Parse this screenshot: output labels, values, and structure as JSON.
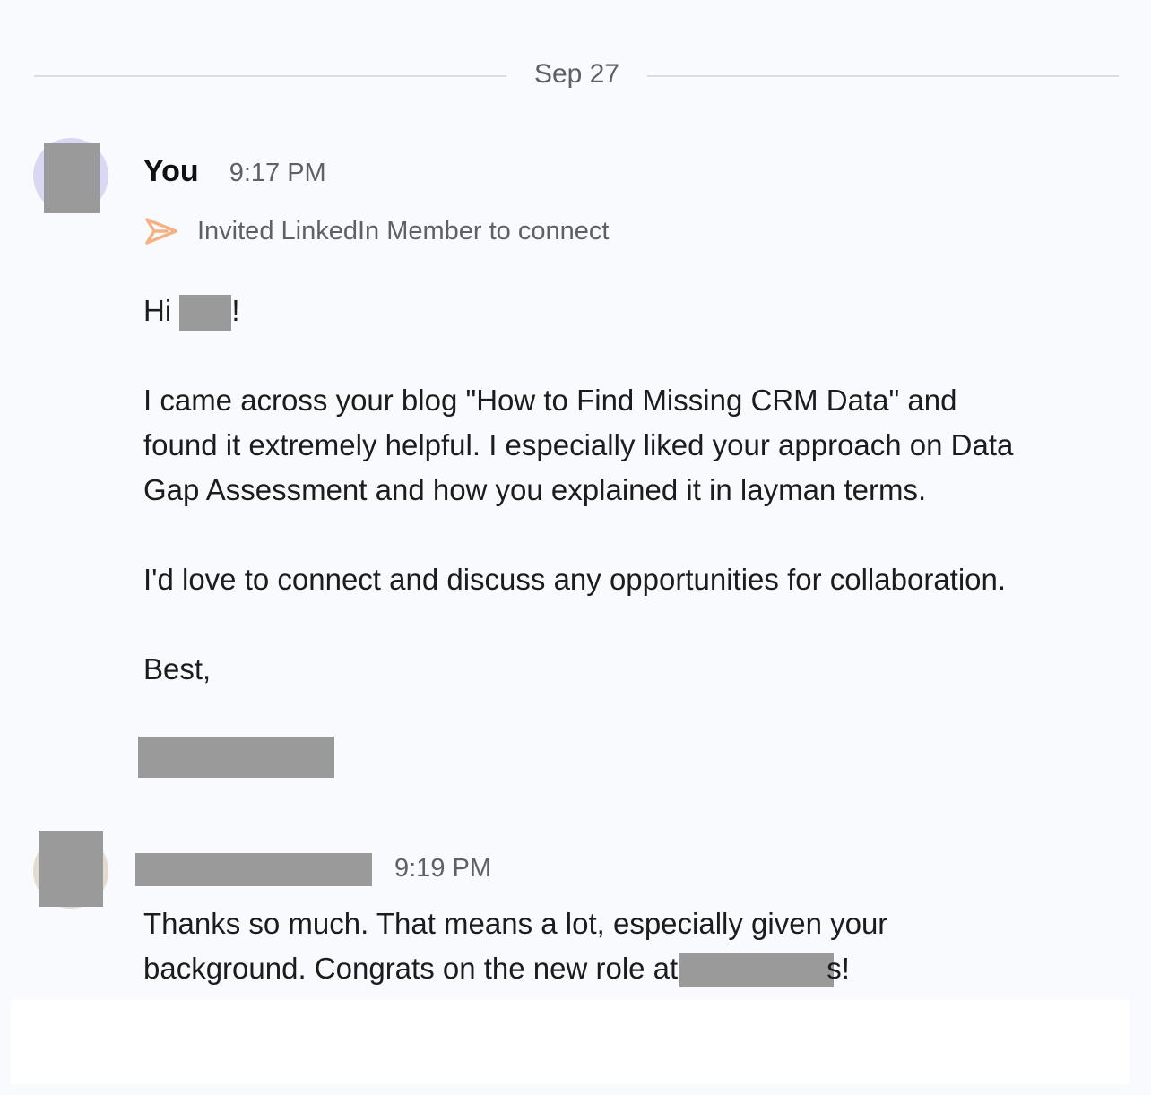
{
  "thread": {
    "date_divider": "Sep 27",
    "messages": [
      {
        "sender": "You",
        "time": "9:17 PM",
        "event_icon": "send-icon",
        "event_text": "Invited LinkedIn Member to connect",
        "greeting_start": "Hi ",
        "greeting_end": "!",
        "paragraph_1_line_1": "I came across your blog \"How to Find Missing CRM Data\" and",
        "paragraph_1_line_2": "found it extremely helpful. I especially liked your approach on Data",
        "paragraph_1_line_3": "Gap Assessment and how you explained it in layman terms.",
        "paragraph_2": "I'd love to connect and discuss any opportunities for collaboration.",
        "signoff": "Best,"
      },
      {
        "time": "9:19 PM",
        "line_1": "Thanks so much. That means a lot, especially given your",
        "line_2_start": "background. Congrats on the new role at",
        "line_2_end": "s!"
      }
    ]
  },
  "colors": {
    "background": "#f9fafd",
    "accent_icon": "#f4b183",
    "redaction": "#9a9a9a",
    "muted_text": "#5f6065"
  }
}
